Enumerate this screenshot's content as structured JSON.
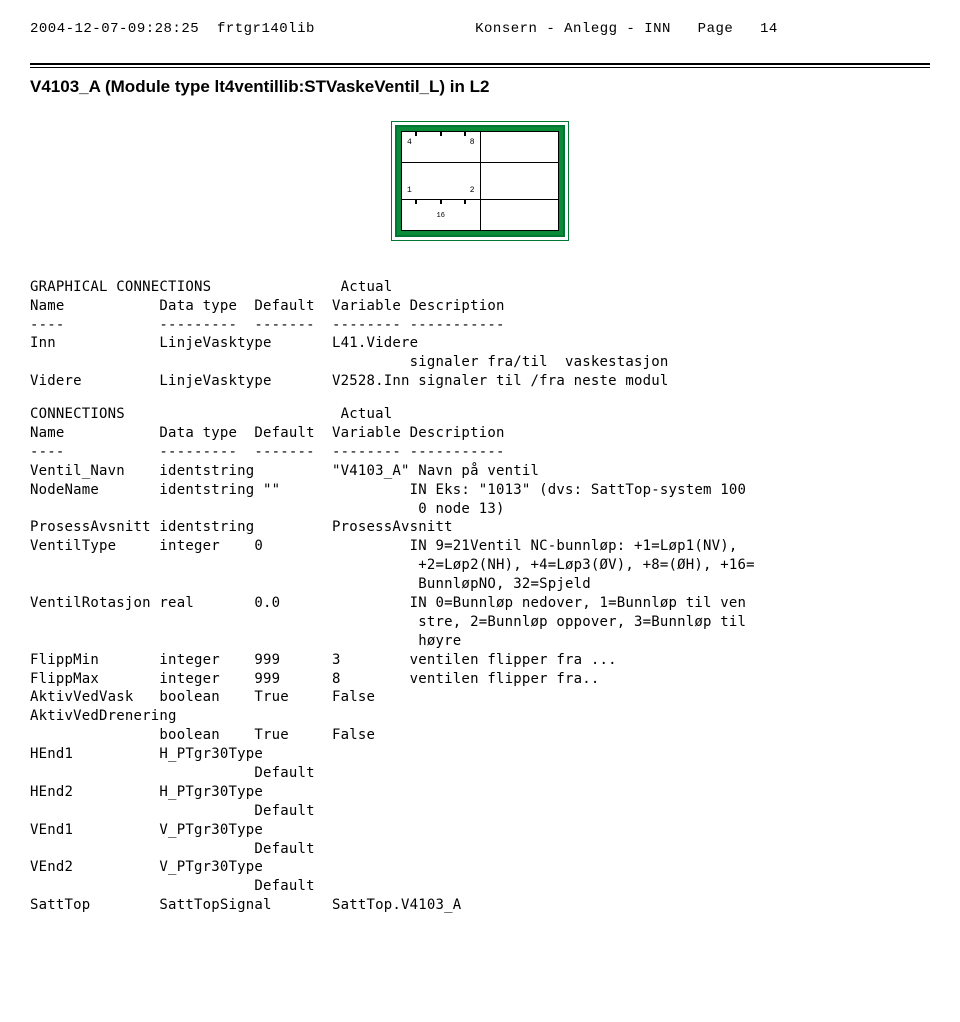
{
  "header": {
    "timestamp": "2004-12-07-09:28:25",
    "lib": "frtgr140lib",
    "context": "Konsern - Anlegg - INN",
    "page_label": "Page",
    "page_num": "14"
  },
  "title": "V4103_A (Module type lt4ventillib:STVaskeVentil_L) in L2",
  "symbol": {
    "n4": "4",
    "n8": "8",
    "n1": "1",
    "n2": "2",
    "n16": "16"
  },
  "graphical": {
    "heading": "GRAPHICAL CONNECTIONS               Actual",
    "cols": "Name           Data type  Default  Variable Description",
    "dashes": "----           ---------  -------  -------- -----------",
    "rows": [
      "Inn            LinjeVasktype       L41.Videre",
      "                                            signaler fra/til  vaskestasjon",
      "Videre         LinjeVasktype       V2528.Inn signaler til /fra neste modul"
    ]
  },
  "connections": {
    "heading": "CONNECTIONS                         Actual",
    "cols": "Name           Data type  Default  Variable Description",
    "dashes": "----           ---------  -------  -------- -----------",
    "rows": [
      "Ventil_Navn    identstring         \"V4103_A\" Navn på ventil",
      "NodeName       identstring \"\"               IN Eks: \"1013\" (dvs: SattTop-system 100",
      "                                             0 node 13)",
      "ProsessAvsnitt identstring         ProsessAvsnitt",
      "VentilType     integer    0                 IN 9=21Ventil NC-bunnløp: +1=Løp1(NV),",
      "                                             +2=Løp2(NH), +4=Løp3(ØV), +8=(ØH), +16=",
      "                                             BunnløpNO, 32=Spjeld",
      "VentilRotasjon real       0.0               IN 0=Bunnløp nedover, 1=Bunnløp til ven",
      "                                             stre, 2=Bunnløp oppover, 3=Bunnløp til",
      "                                             høyre",
      "FlippMin       integer    999      3        ventilen flipper fra ...",
      "FlippMax       integer    999      8        ventilen flipper fra..",
      "AktivVedVask   boolean    True     False",
      "AktivVedDrenering",
      "               boolean    True     False",
      "HEnd1          H_PTgr30Type",
      "                          Default",
      "HEnd2          H_PTgr30Type",
      "                          Default",
      "VEnd1          V_PTgr30Type",
      "                          Default",
      "VEnd2          V_PTgr30Type",
      "                          Default",
      "SattTop        SattTopSignal       SattTop.V4103_A"
    ]
  }
}
